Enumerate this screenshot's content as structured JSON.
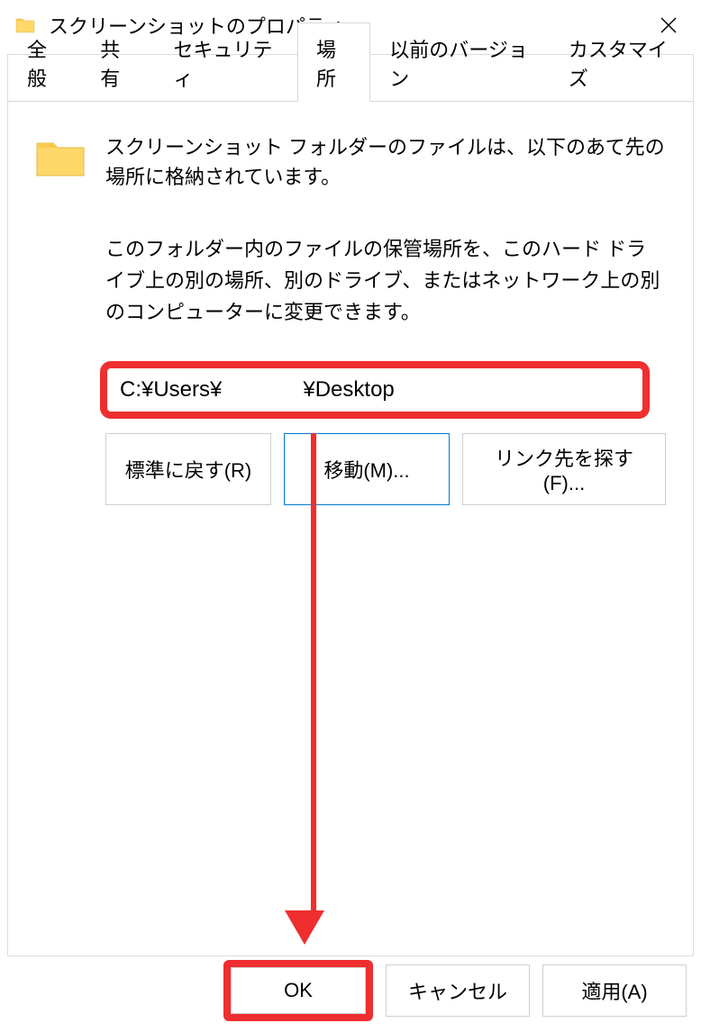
{
  "titlebar": {
    "title": "スクリーンショットのプロパティ"
  },
  "tabs": {
    "general": "全般",
    "share": "共有",
    "security": "セキュリティ",
    "location": "場所",
    "previous": "以前のバージョン",
    "customize": "カスタマイズ"
  },
  "content": {
    "intro": "スクリーンショット フォルダーのファイルは、以下のあて先の場所に格納されています。",
    "help": "このフォルダー内のファイルの保管場所を、このハード ドライブ上の別の場所、別のドライブ、またはネットワーク上の別のコンピューターに変更できます。",
    "path_prefix": "C:¥Users¥",
    "path_suffix": "¥Desktop"
  },
  "buttons": {
    "restore": "標準に戻す(R)",
    "move": "移動(M)...",
    "find": "リンク先を探す(F)...",
    "ok": "OK",
    "cancel": "キャンセル",
    "apply": "適用(A)"
  }
}
